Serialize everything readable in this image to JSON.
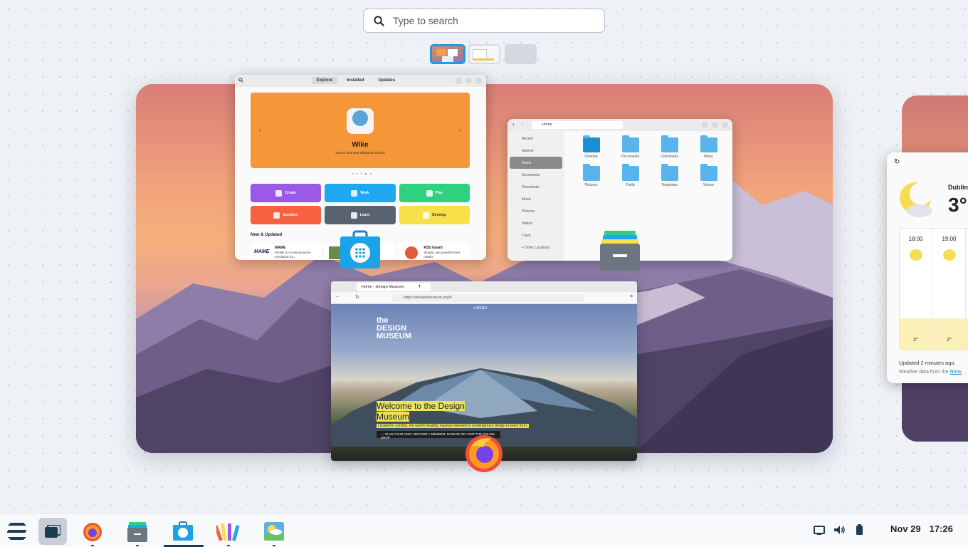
{
  "search": {
    "placeholder": "Type to search"
  },
  "software": {
    "tabs": [
      "Explore",
      "Installed",
      "Updates"
    ],
    "featured_title": "Wike",
    "featured_subtitle": "Search and read Wikipedia articles",
    "categories": [
      {
        "label": "Create",
        "color": "#9b59e8"
      },
      {
        "label": "Work",
        "color": "#1ea8f2"
      },
      {
        "label": "Play",
        "color": "#2ed17e"
      },
      {
        "label": "Socialize",
        "color": "#f5623d"
      },
      {
        "label": "Learn",
        "color": "#596370"
      },
      {
        "label": "Develop",
        "color": "#f8e04a"
      }
    ],
    "new_heading": "New & Updated",
    "apps": [
      {
        "name": "MAME",
        "desc": "MAME is a multi-purpose emulation fra..."
      },
      {
        "name": "",
        "desc": ""
      },
      {
        "name": "RSS Guard",
        "desc": "Simple, yet powerful feed reader"
      }
    ]
  },
  "files": {
    "location": "Home",
    "sidebar": [
      "Recent",
      "Starred",
      "Home",
      "Documents",
      "Downloads",
      "Music",
      "Pictures",
      "Videos",
      "Trash",
      "+ Other Locations"
    ],
    "folders": [
      "Desktop",
      "Documents",
      "Downloads",
      "Music",
      "Pictures",
      "Public",
      "Templates",
      "Videos"
    ]
  },
  "browser": {
    "tab_title": "Home - Design Museum",
    "url": "https://designmuseum.org/#",
    "menu": "≡ MENU",
    "logo": [
      "the",
      "DESIGN",
      "MUSEUM"
    ],
    "headline_1": "Welcome to the Design",
    "headline_2": "Museum",
    "description": "Located in London, the world's leading museum devoted to contemporary design in every form.",
    "cta": "→ PLAN YOUR VISIT, BECOME A MEMBER, DONATE OR VISIT THE ONLINE SHOP"
  },
  "weather": {
    "city": "Dublin,",
    "temperature": "3°",
    "hours": [
      {
        "time": "18:00",
        "temp": "2°"
      },
      {
        "time": "19:00",
        "temp": "2°"
      }
    ],
    "updated": "Updated 2 minutes ago.",
    "source_prefix": "Weather data from the",
    "source_link": "Norw"
  },
  "clock": {
    "date": "Nov 29",
    "time": "17:26"
  },
  "taskbar": {
    "apps": [
      "zorin-menu",
      "workspaces",
      "firefox",
      "files",
      "software",
      "color-palette",
      "weather"
    ]
  },
  "colors": {
    "accent": "#1e9be3",
    "orange_banner": "#f59639"
  }
}
